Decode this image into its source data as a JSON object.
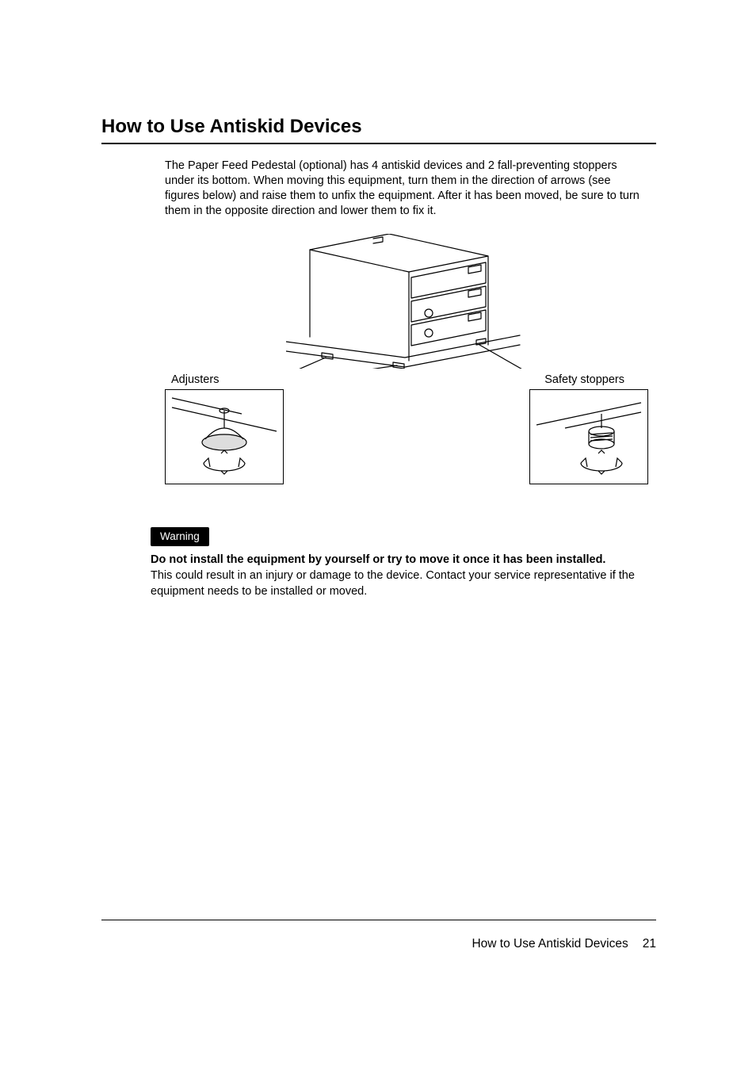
{
  "heading": "How to Use Antiskid Devices",
  "intro": "The Paper Feed Pedestal (optional) has 4 antiskid devices and 2 fall-preventing stoppers under its bottom. When moving this equipment, turn them in the direction of arrows (see figures below) and raise them to unfix the equipment. After it has been moved, be sure to turn them in the opposite direction and lower them to fix it.",
  "figure": {
    "label_left": "Adjusters",
    "label_right": "Safety stoppers"
  },
  "warning": {
    "badge": "Warning",
    "bold": "Do not install the equipment by yourself or try to move it once it has been installed.",
    "body": "This could result in an injury or damage to the device. Contact your service representative if the equipment needs to be installed or moved."
  },
  "footer": {
    "title": "How to Use Antiskid Devices",
    "page": "21"
  }
}
